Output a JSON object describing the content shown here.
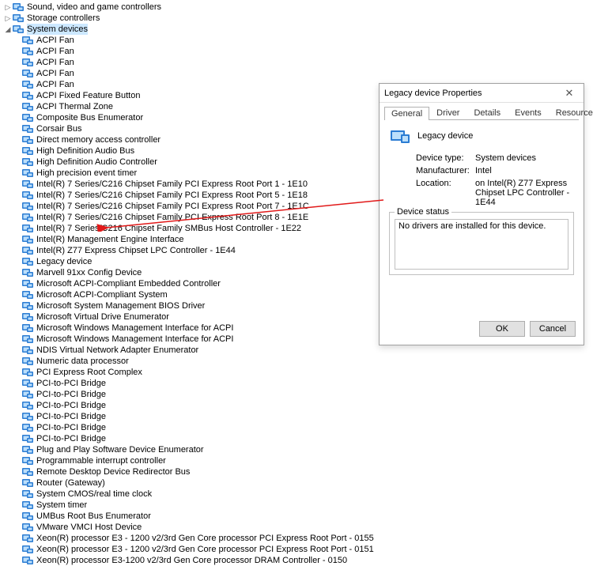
{
  "tree": {
    "categories": [
      {
        "label": "Sound, video and game controllers",
        "expand": "▷",
        "indent": 0
      },
      {
        "label": "Storage controllers",
        "expand": "▷",
        "indent": 0
      },
      {
        "label": "System devices",
        "expand": "◢",
        "selected": true,
        "indent": 0
      }
    ],
    "devices": [
      "ACPI Fan",
      "ACPI Fan",
      "ACPI Fan",
      "ACPI Fan",
      "ACPI Fan",
      "ACPI Fixed Feature Button",
      "ACPI Thermal Zone",
      "Composite Bus Enumerator",
      "Corsair Bus",
      "Direct memory access controller",
      "High Definition Audio Bus",
      "High Definition Audio Controller",
      "High precision event timer",
      "Intel(R) 7 Series/C216 Chipset Family PCI Express Root Port 1 - 1E10",
      "Intel(R) 7 Series/C216 Chipset Family PCI Express Root Port 5 - 1E18",
      "Intel(R) 7 Series/C216 Chipset Family PCI Express Root Port 7 - 1E1C",
      "Intel(R) 7 Series/C216 Chipset Family PCI Express Root Port 8 - 1E1E",
      "Intel(R) 7 Series/C216 Chipset Family SMBus Host Controller - 1E22",
      "Intel(R) Management Engine Interface",
      "Intel(R) Z77 Express Chipset LPC Controller - 1E44",
      "Legacy device",
      "Marvell 91xx Config Device",
      "Microsoft ACPI-Compliant Embedded Controller",
      "Microsoft ACPI-Compliant System",
      "Microsoft System Management BIOS Driver",
      "Microsoft Virtual Drive Enumerator",
      "Microsoft Windows Management Interface for ACPI",
      "Microsoft Windows Management Interface for ACPI",
      "NDIS Virtual Network Adapter Enumerator",
      "Numeric data processor",
      "PCI Express Root Complex",
      "PCI-to-PCI Bridge",
      "PCI-to-PCI Bridge",
      "PCI-to-PCI Bridge",
      "PCI-to-PCI Bridge",
      "PCI-to-PCI Bridge",
      "PCI-to-PCI Bridge",
      "Plug and Play Software Device Enumerator",
      "Programmable interrupt controller",
      "Remote Desktop Device Redirector Bus",
      "Router (Gateway)",
      "System CMOS/real time clock",
      "System timer",
      "UMBus Root Bus Enumerator",
      "VMware VMCI Host Device",
      "Xeon(R) processor E3 - 1200 v2/3rd Gen Core processor PCI Express Root Port - 0155",
      "Xeon(R) processor E3 - 1200 v2/3rd Gen Core processor PCI Express Root Port - 0151",
      "Xeon(R) processor E3-1200 v2/3rd Gen Core processor DRAM Controller - 0150"
    ]
  },
  "dialog": {
    "title": "Legacy device Properties",
    "tabs": [
      "General",
      "Driver",
      "Details",
      "Events",
      "Resources"
    ],
    "active_tab": "General",
    "device_name": "Legacy device",
    "info": {
      "device_type_k": "Device type:",
      "device_type_v": "System devices",
      "manufacturer_k": "Manufacturer:",
      "manufacturer_v": "Intel",
      "location_k": "Location:",
      "location_v": "on Intel(R) Z77 Express Chipset LPC Controller - 1E44"
    },
    "status_label": "Device status",
    "status_text": "No drivers are installed for this device.",
    "ok_label": "OK",
    "cancel_label": "Cancel",
    "close_glyph": "✕"
  },
  "colors": {
    "arrow": "#e11919",
    "device_icon": "#2b7cd3"
  }
}
